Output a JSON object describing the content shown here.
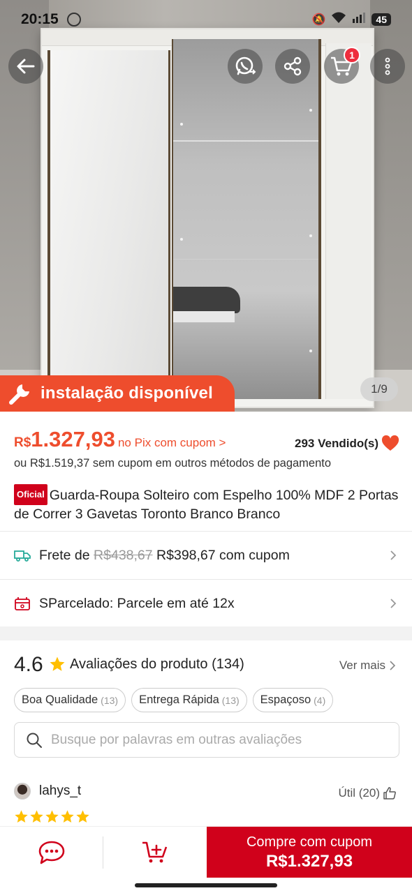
{
  "status_bar": {
    "time": "20:15",
    "battery": "45"
  },
  "hero": {
    "install_label": "instalação disponível",
    "image_counter": "1/9",
    "cart_count": "1"
  },
  "price": {
    "currency": "R$",
    "amount": "1.327,93",
    "pix_label": "no Pix com cupom >",
    "sold": "293 Vendido(s)",
    "alt_price_text": "ou R$1.519,37 sem cupom em outros métodos de pagamento"
  },
  "product": {
    "badge": "Oficial",
    "title": "Guarda-Roupa Solteiro com Espelho 100% MDF 2 Portas de Correr 3 Gavetas Toronto Branco Branco"
  },
  "shipping": {
    "label": "Frete de",
    "old_price": "R$438,67",
    "new_price": "R$398,67 com cupom"
  },
  "installments": {
    "label": "SParcelado: Parcele em até 12x"
  },
  "reviews": {
    "rating": "4.6",
    "title": "Avaliações do produto",
    "count": "(134)",
    "see_more": "Ver mais",
    "chips": [
      {
        "label": "Boa Qualidade",
        "count": "(13)"
      },
      {
        "label": "Entrega Rápida",
        "count": "(13)"
      },
      {
        "label": "Espaçoso",
        "count": "(4)"
      }
    ],
    "search_placeholder": "Busque por palavras em outras avaliações",
    "first_review": {
      "username": "lahys_t",
      "helpful": "Útil (20)",
      "stars": 5
    }
  },
  "bottom_bar": {
    "buy_label": "Compre com cupom",
    "buy_price": "R$1.327,93"
  },
  "colors": {
    "brand": "#ee4d2d",
    "buy": "#d0011b",
    "star": "#ffbf00",
    "heart": "#ee4d2d"
  }
}
